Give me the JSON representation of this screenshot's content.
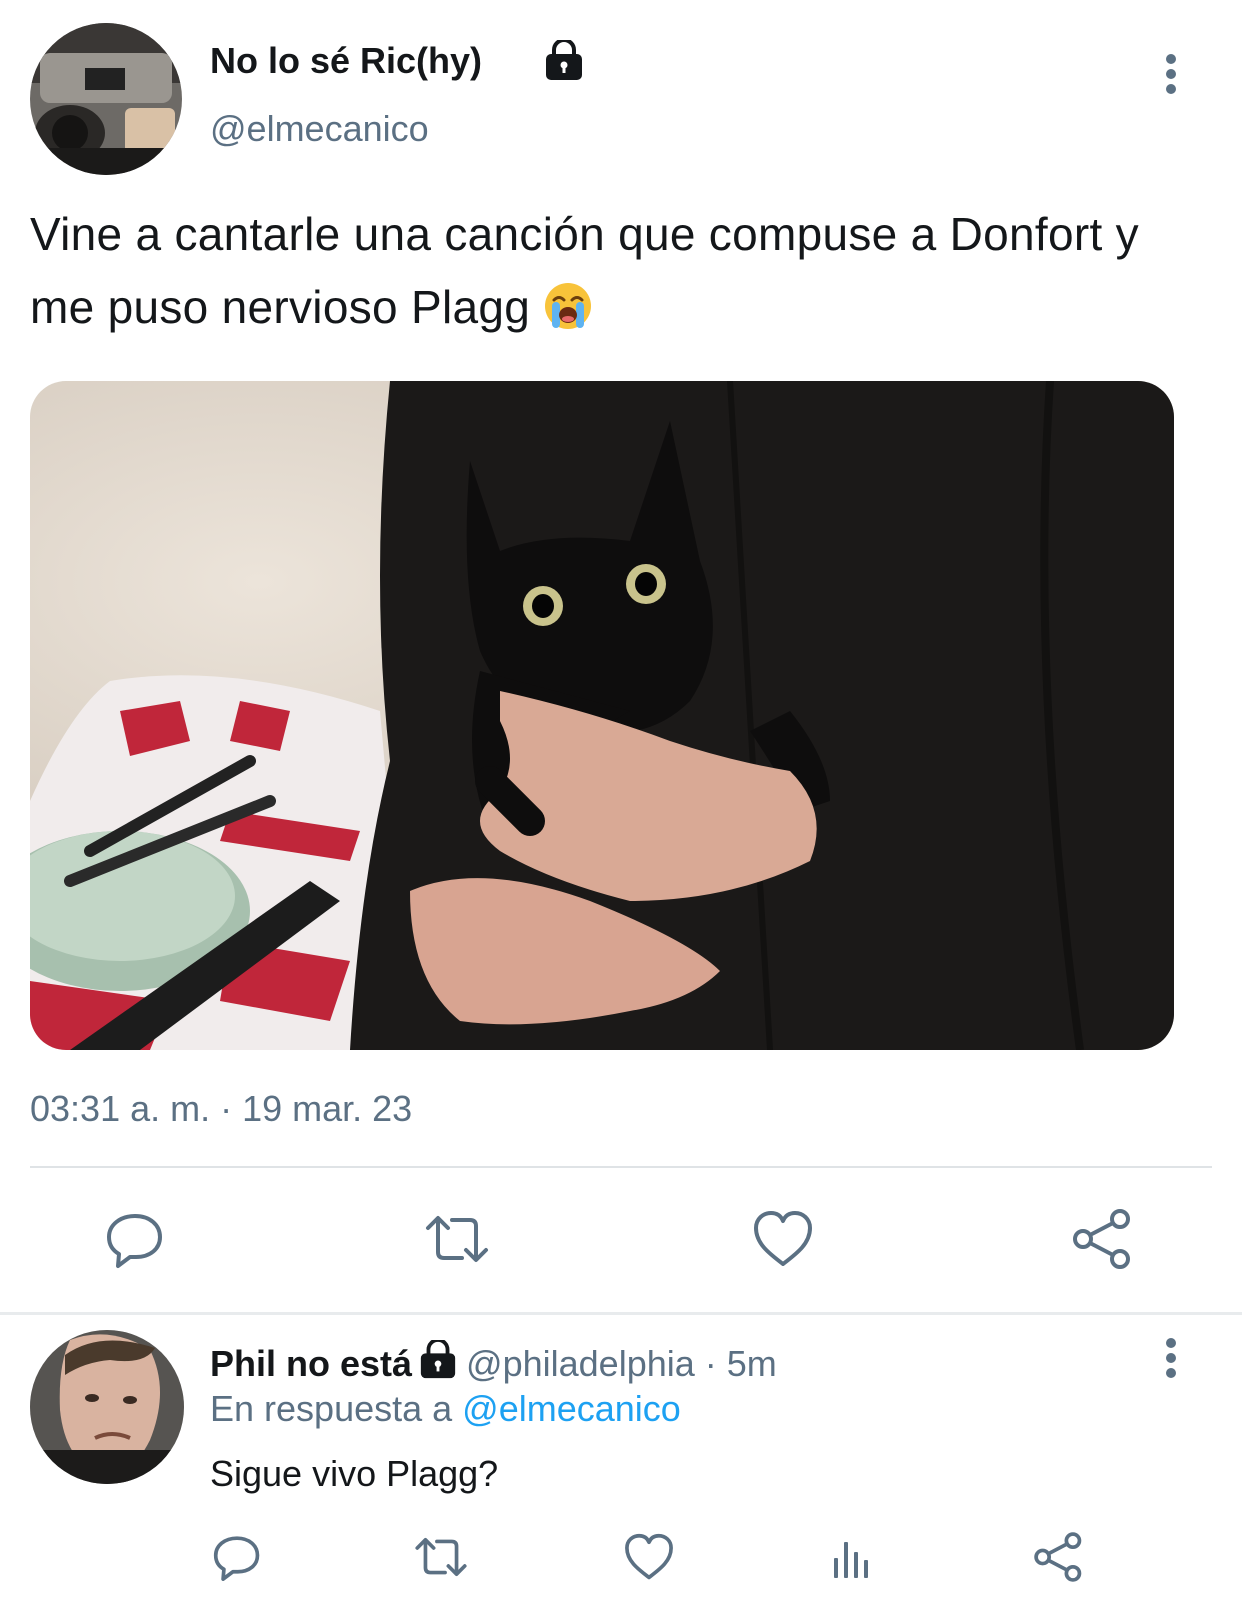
{
  "main_tweet": {
    "display_name": "No lo sé Ric(hy)",
    "handle": "@elmecanico",
    "text": "Vine a cantarle una canción que compuse a Donfort y me puso nervioso Plagg",
    "emoji": "loudly-crying-face",
    "timestamp": "03:31 a. m. · 19 mar. 23",
    "protected": true
  },
  "reply_tweet": {
    "display_name": "Phil no está",
    "handle_time": "@philadelphia · 5m",
    "context_prefix": "En respuesta a",
    "context_mention": "@elmecanico",
    "text": "Sigue vivo Plagg?",
    "protected": true
  },
  "colors": {
    "text_primary": "#14171a",
    "text_secondary": "#5b7083",
    "link": "#1da1f2",
    "divider": "#dfe3e6"
  },
  "icons": {
    "main_actions": [
      "reply-icon",
      "retweet-icon",
      "like-icon",
      "share-icon"
    ],
    "reply_actions": [
      "reply-icon",
      "retweet-icon",
      "like-icon",
      "stats-icon",
      "share-icon"
    ]
  }
}
